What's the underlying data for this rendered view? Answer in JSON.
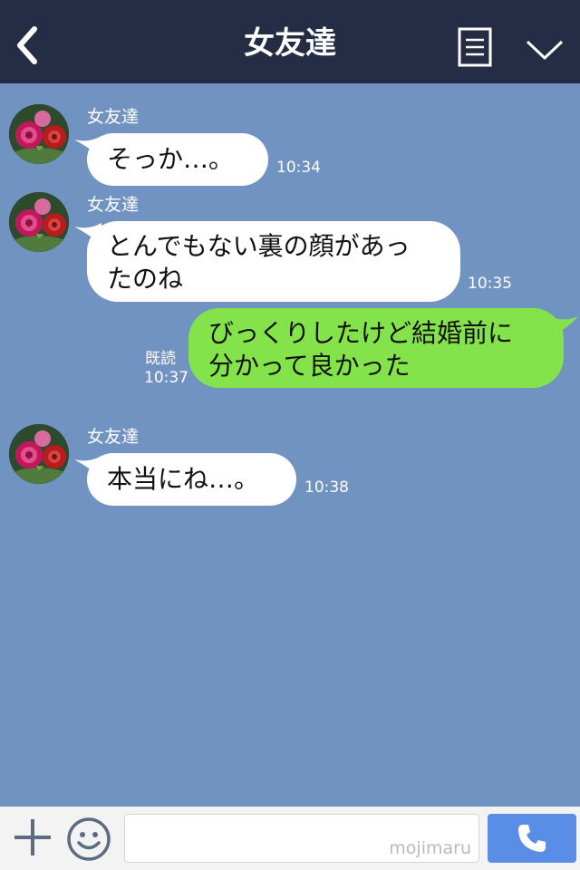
{
  "header": {
    "title": "女友達",
    "back_icon": "chevron-left-icon",
    "menu_icon": "notes-list-icon",
    "expand_icon": "chevron-down-icon",
    "background": "#252d44"
  },
  "chat": {
    "background": "#7193c2",
    "messages": [
      {
        "direction": "incoming",
        "sender": "女友達",
        "lines": [
          "そっか…。"
        ],
        "time": "10:34"
      },
      {
        "direction": "incoming",
        "sender": "女友達",
        "lines": [
          "とんでもない裏の顔があっ",
          "たのね"
        ],
        "time": "10:35"
      },
      {
        "direction": "outgoing",
        "read_label": "既読",
        "lines": [
          "びっくりしたけど結婚前に",
          "分かって良かった"
        ],
        "time": "10:37"
      },
      {
        "direction": "incoming",
        "sender": "女友達",
        "lines": [
          "本当にね…。"
        ],
        "time": "10:38"
      }
    ],
    "incoming_bubble_color": "#ffffff",
    "outgoing_bubble_color": "#84e34a"
  },
  "footer": {
    "plus_icon": "plus-icon",
    "emoji_icon": "smiley-icon",
    "input_value": "",
    "watermark": "mojimaru",
    "call_icon": "phone-icon",
    "call_button_color": "#5a8ee6"
  }
}
